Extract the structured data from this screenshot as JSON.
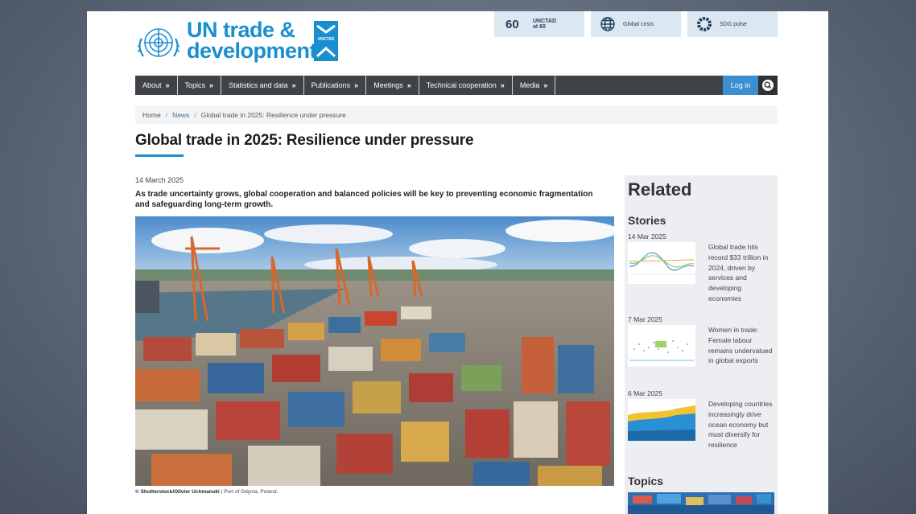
{
  "header": {
    "logo_line1": "UN trade &",
    "logo_line2": "development",
    "logo_mark": "UNCTAD",
    "top_links": [
      {
        "label": "UNCTAD at 60",
        "icon": "unctad60-icon"
      },
      {
        "label": "Global crisis",
        "icon": "globe-icon"
      },
      {
        "label": "SDG pulse",
        "icon": "sdg-wheel-icon"
      }
    ]
  },
  "nav": {
    "items": [
      "About",
      "Topics",
      "Statistics and data",
      "Publications",
      "Meetings",
      "Technical cooperation",
      "Media"
    ],
    "login": "Log in",
    "search_icon": "search-icon"
  },
  "breadcrumb": [
    "Home",
    "News",
    "Global trade in 2025: Resilience under pressure"
  ],
  "article": {
    "title": "Global trade in 2025: Resilience under pressure",
    "date": "14 March 2025",
    "lead": "As trade uncertainty grows, global cooperation and balanced policies will be key to preventing economic fragmentation and safeguarding long-term growth.",
    "caption_credit": "© Shutterstock/Olivier Uchmanski",
    "caption_text": "Port of Gdynia, Poland."
  },
  "sidebar": {
    "title": "Related",
    "stories_title": "Stories",
    "stories": [
      {
        "date": "14 Mar 2025",
        "text": "Global trade hits record $33 trillion in 2024, driven by services and developing economies"
      },
      {
        "date": "7 Mar 2025",
        "text": "Women in trade: Female labour remains undervalued in global exports"
      },
      {
        "date": "6 Mar 2025",
        "text": "Developing countries increasingly drive ocean economy but must diversify for resilience"
      }
    ],
    "topics_title": "Topics"
  },
  "colors": {
    "brand": "#1a8fcf",
    "nav_bg": "#3f4347",
    "login_bg": "#3a8fd2"
  }
}
